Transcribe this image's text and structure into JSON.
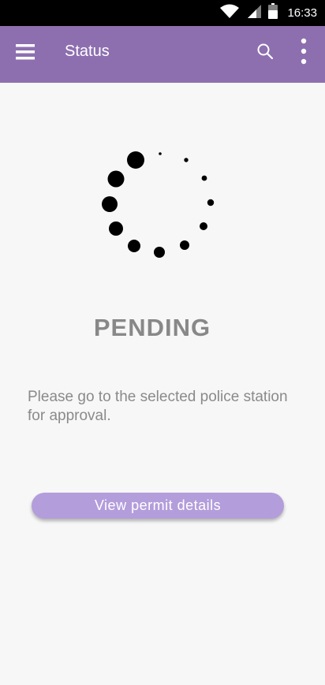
{
  "status_bar": {
    "time": "16:33",
    "icons": [
      "wifi-icon",
      "cellular-signal-icon",
      "battery-icon"
    ]
  },
  "app_bar": {
    "title": "Status",
    "background": "#8d6fb0",
    "left_icon": "menu-icon",
    "right_icons": [
      "search-icon",
      "more-vert-icon"
    ]
  },
  "main": {
    "loader_icon": "loading-spinner-icon",
    "status_text": "PENDING",
    "message": "Please go to the selected police station for approval.",
    "button_label": "View permit details",
    "button_color": "#b39ddb"
  }
}
